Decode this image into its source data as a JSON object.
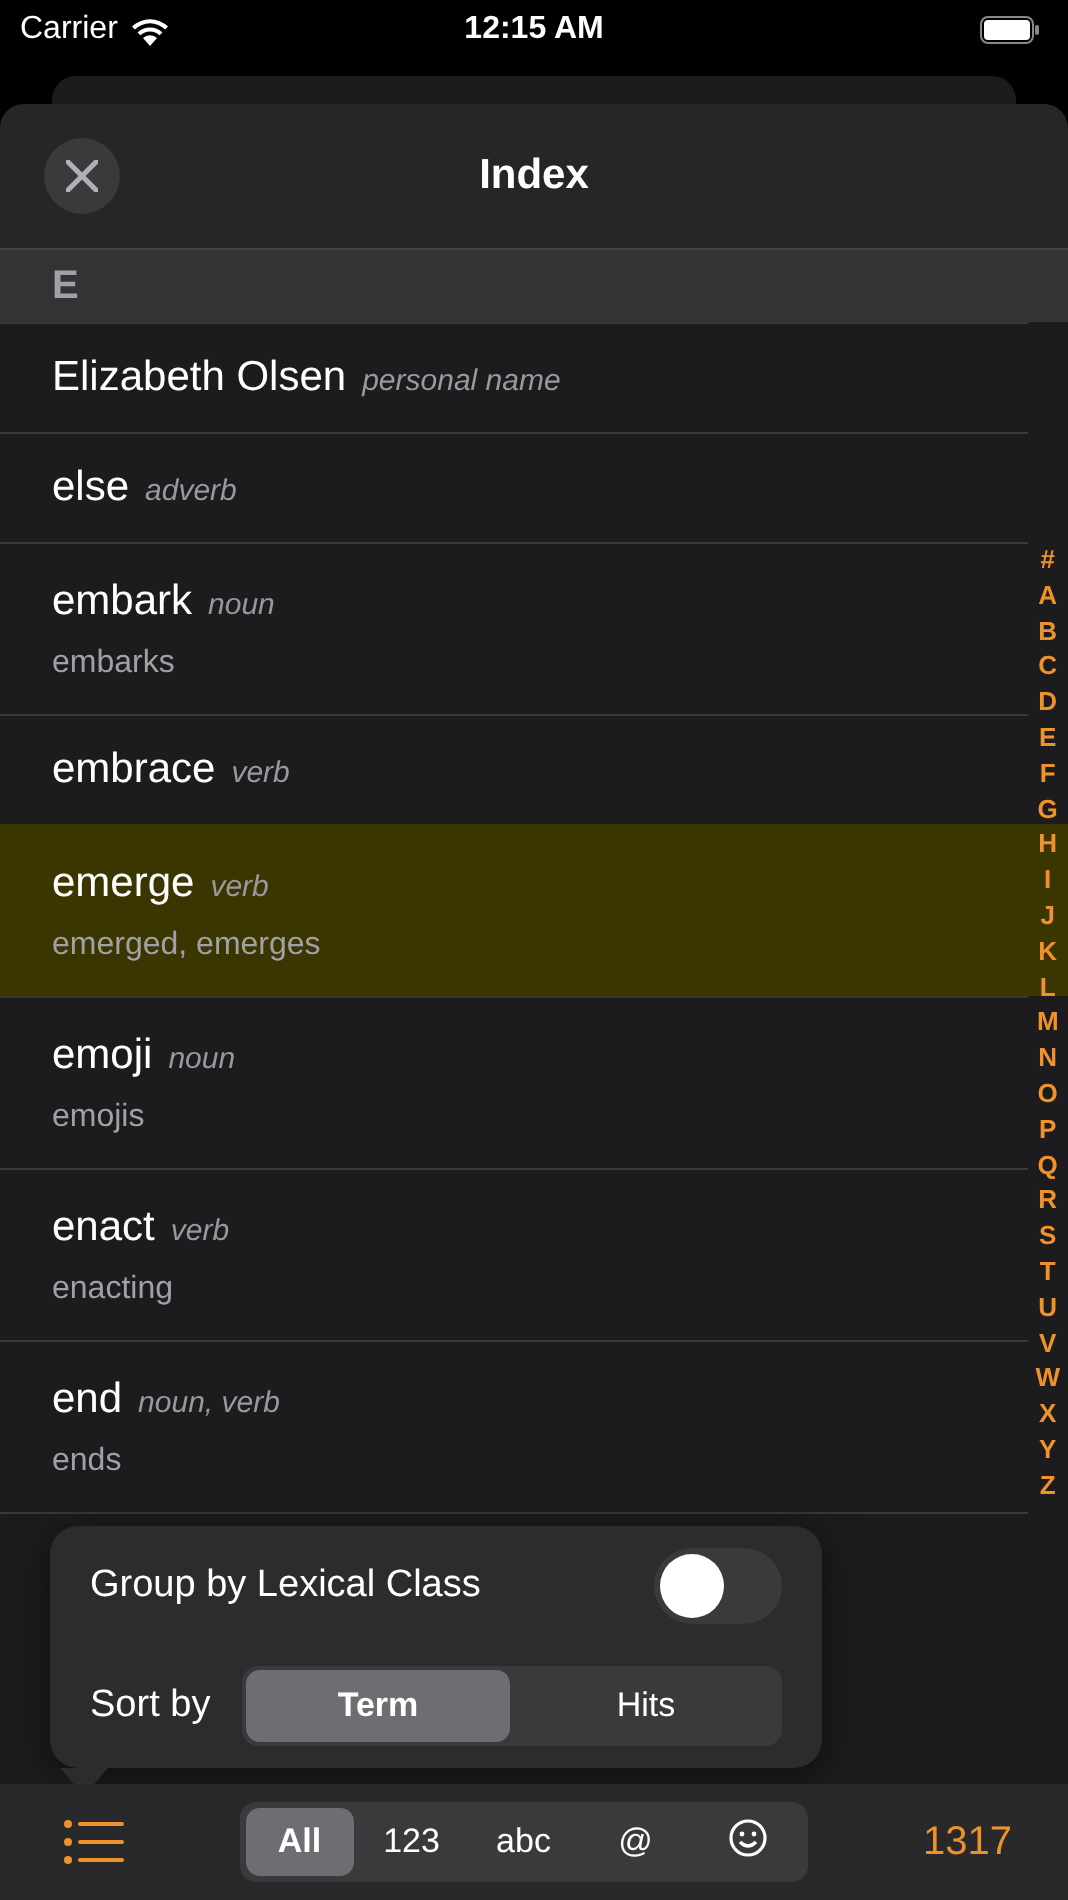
{
  "status_bar": {
    "carrier": "Carrier",
    "time": "12:15 AM"
  },
  "header": {
    "title": "Index"
  },
  "section": {
    "letter": "E"
  },
  "entries": [
    {
      "term": "Elizabeth Olsen",
      "pos": "personal name",
      "selected": false
    },
    {
      "term": "else",
      "pos": "adverb",
      "selected": false
    },
    {
      "term": "embark",
      "pos": "noun",
      "forms": "embarks",
      "selected": false
    },
    {
      "term": "embrace",
      "pos": "verb",
      "selected": false
    },
    {
      "term": "emerge",
      "pos": "verb",
      "forms": "emerged, emerges",
      "selected": true
    },
    {
      "term": "emoji",
      "pos": "noun",
      "forms": "emojis",
      "selected": false
    },
    {
      "term": "enact",
      "pos": "verb",
      "forms": "enacting",
      "selected": false
    },
    {
      "term": "end",
      "pos": "noun, verb",
      "forms": "ends",
      "selected": false
    }
  ],
  "index_letters": [
    "#",
    "A",
    "B",
    "C",
    "D",
    "E",
    "F",
    "G",
    "H",
    "I",
    "J",
    "K",
    "L",
    "M",
    "N",
    "O",
    "P",
    "Q",
    "R",
    "S",
    "T",
    "U",
    "V",
    "W",
    "X",
    "Y",
    "Z"
  ],
  "popover": {
    "group_label": "Group by Lexical Class",
    "group_on": false,
    "sort_label": "Sort by",
    "sort_options": [
      {
        "label": "Term",
        "selected": true
      },
      {
        "label": "Hits",
        "selected": false
      }
    ]
  },
  "toolbar": {
    "filters": [
      {
        "label": "All",
        "selected": true
      },
      {
        "label": "123",
        "selected": false
      },
      {
        "label": "abc",
        "selected": false
      },
      {
        "label": "@",
        "selected": false
      },
      {
        "kind": "smiley",
        "selected": false
      }
    ],
    "count": "1317"
  }
}
